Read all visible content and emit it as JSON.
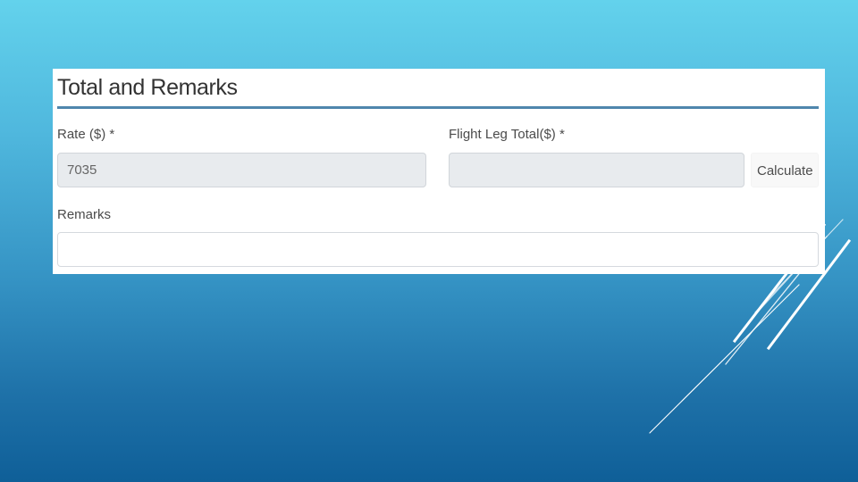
{
  "panel": {
    "title": "Total and Remarks",
    "fields": {
      "rate": {
        "label": "Rate ($) *",
        "value": "7035"
      },
      "flight_leg_total": {
        "label": "Flight Leg Total($) *",
        "value": "",
        "button_label": "Calculate"
      },
      "remarks": {
        "label": "Remarks",
        "value": ""
      }
    }
  },
  "colors": {
    "background_top": "#63d2ec",
    "background_bottom": "#0f5f98",
    "panel": "#ffffff",
    "divider": "#4f86ad",
    "readonly_input": "#e8ebee"
  }
}
